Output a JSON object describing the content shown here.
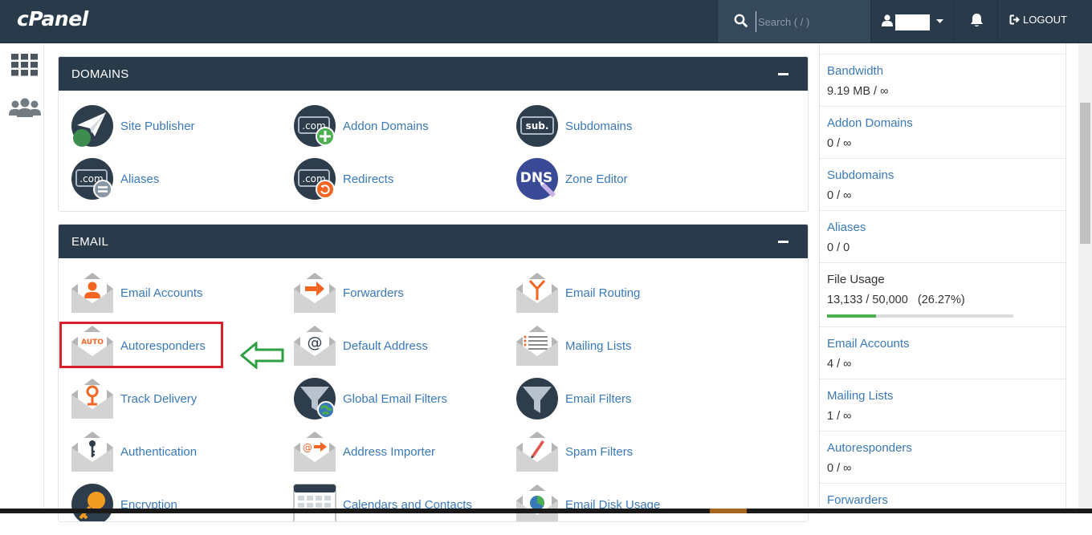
{
  "header": {
    "logo": "cPanel",
    "search_placeholder": "Search ( / )",
    "logout_label": "LOGOUT"
  },
  "sidebar": {
    "icons": [
      "grid-icon",
      "users-icon"
    ]
  },
  "domains": {
    "title": "DOMAINS",
    "items": [
      {
        "label": "Site Publisher",
        "icon": "site-publisher-icon"
      },
      {
        "label": "Addon Domains",
        "icon": "addon-domains-icon"
      },
      {
        "label": "Subdomains",
        "icon": "subdomains-icon"
      },
      {
        "label": "Aliases",
        "icon": "aliases-icon"
      },
      {
        "label": "Redirects",
        "icon": "redirects-icon"
      },
      {
        "label": "Zone Editor",
        "icon": "zone-editor-icon"
      }
    ],
    "icon_text": {
      "com": ".com",
      "sub": "sub.",
      "dns": "DNS"
    }
  },
  "email": {
    "title": "EMAIL",
    "items": [
      {
        "label": "Email Accounts",
        "icon": "email-accounts-icon"
      },
      {
        "label": "Forwarders",
        "icon": "forwarders-icon"
      },
      {
        "label": "Email Routing",
        "icon": "email-routing-icon"
      },
      {
        "label": "Autoresponders",
        "icon": "autoresponders-icon"
      },
      {
        "label": "Default Address",
        "icon": "default-address-icon"
      },
      {
        "label": "Mailing Lists",
        "icon": "mailing-lists-icon"
      },
      {
        "label": "Track Delivery",
        "icon": "track-delivery-icon"
      },
      {
        "label": "Global Email Filters",
        "icon": "global-email-filters-icon"
      },
      {
        "label": "Email Filters",
        "icon": "email-filters-icon"
      },
      {
        "label": "Authentication",
        "icon": "authentication-icon"
      },
      {
        "label": "Address Importer",
        "icon": "address-importer-icon"
      },
      {
        "label": "Spam Filters",
        "icon": "spam-filters-icon"
      },
      {
        "label": "Encryption",
        "icon": "encryption-icon"
      },
      {
        "label": "Calendars and Contacts",
        "icon": "calendars-contacts-icon"
      },
      {
        "label": "Email Disk Usage",
        "icon": "email-disk-usage-icon"
      }
    ],
    "icon_text": {
      "auto": "AUTO",
      "at": "@"
    }
  },
  "stats": [
    {
      "name": "Bandwidth",
      "value": "9.19 MB / ∞"
    },
    {
      "name": "Addon Domains",
      "value": "0 / ∞"
    },
    {
      "name": "Subdomains",
      "value": "0 / ∞"
    },
    {
      "name": "Aliases",
      "value": "0 / 0"
    },
    {
      "name": "File Usage",
      "value": "13,133 / 50,000   (26.27%)",
      "usage_fraction": 0.2627
    },
    {
      "name": "Email Accounts",
      "value": "4 / ∞"
    },
    {
      "name": "Mailing Lists",
      "value": "1 / ∞"
    },
    {
      "name": "Autoresponders",
      "value": "0 / ∞"
    },
    {
      "name": "Forwarders",
      "value": ""
    }
  ],
  "colors": {
    "header_bg": "#293a4a",
    "link": "#3a79b7",
    "highlight": "#d6212a",
    "arrow": "#2ea043",
    "usage_fill": "#4caf50"
  }
}
